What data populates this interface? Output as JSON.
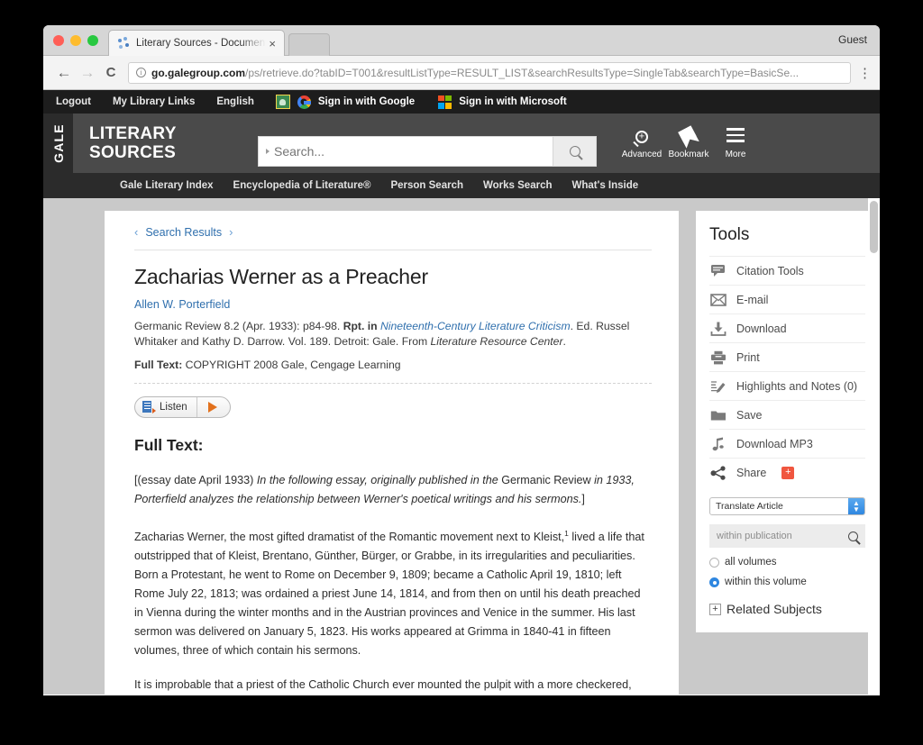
{
  "browser": {
    "tab": {
      "title": "Literary Sources - Document",
      "close": "×",
      "favicon": "spinner-icon"
    },
    "profile_label": "Guest",
    "nav": {
      "back": "←",
      "forward": "→",
      "reload": "C",
      "menu": "⋮"
    },
    "omnibox": {
      "info": "i",
      "host": "go.galegroup.com",
      "path": "/ps/retrieve.do?tabID=T001&resultListType=RESULT_LIST&searchResultsType=SingleTab&searchType=BasicSe...",
      "full_url": "go.galegroup.com/ps/retrieve.do?tabID=T001&resultListType=RESULT_LIST&searchResultsType=SingleTab&searchType=BasicSe..."
    }
  },
  "utility_bar": {
    "links": [
      "Logout",
      "My Library Links",
      "English"
    ],
    "signins": [
      {
        "label": "Sign in with Google",
        "icon": "google-icon",
        "prefix_icon": "google-classroom-icon"
      },
      {
        "label": "Sign in with Microsoft",
        "icon": "microsoft-icon"
      }
    ]
  },
  "masthead": {
    "gale": "GALE",
    "brand_line1": "LITERARY",
    "brand_line2": "SOURCES",
    "search_placeholder": "Search...",
    "search_value": "",
    "actions": [
      {
        "label": "Advanced",
        "icon": "magnifier-plus-icon"
      },
      {
        "label": "Bookmark",
        "icon": "bookmark-ribbon-icon"
      },
      {
        "label": "More",
        "icon": "hamburger-icon"
      }
    ]
  },
  "navbar": {
    "items": [
      "Gale Literary Index",
      "Encyclopedia of Literature®",
      "Person Search",
      "Works Search",
      "What's Inside"
    ]
  },
  "article": {
    "breadcrumb": {
      "prev": "‹",
      "label": "Search Results",
      "next": "›"
    },
    "title": "Zacharias Werner as a Preacher",
    "author": "Allen W. Porterfield",
    "citation_pre": "Germanic Review 8.2 (Apr. 1933): p84-98. ",
    "citation_rpt": "Rpt. in ",
    "citation_link": "Nineteenth-Century Literature Criticism",
    "citation_post": ". Ed. Russel Whitaker and Kathy D. Darrow. Vol. 189. Detroit: Gale. From ",
    "citation_source": "Literature Resource Center",
    "citation_end": ".",
    "copyright_label": "Full Text:",
    "copyright_text": " COPYRIGHT 2008 Gale, Cengage Learning",
    "listen_label": "Listen",
    "fulltext_heading": "Full Text:",
    "paragraphs": [
      {
        "parts": [
          {
            "text": "[(essay date April 1933) ",
            "style": "normal"
          },
          {
            "text": "In the following essay, originally published in the ",
            "style": "italic"
          },
          {
            "text": "Germanic Review ",
            "style": "normal"
          },
          {
            "text": "in 1933, Porterfield analyzes the relationship between Werner's poetical writings and his sermons.",
            "style": "italic"
          },
          {
            "text": "]",
            "style": "normal"
          }
        ]
      },
      {
        "parts": [
          {
            "text": "Zacharias Werner, the most gifted dramatist of the Romantic movement next to Kleist,",
            "style": "normal"
          },
          {
            "text": "1",
            "style": "sup"
          },
          {
            "text": " lived a life that outstripped that of Kleist, Brentano, Günther, Bürger, or Grabbe, in its irregularities and peculiarities. Born a Protestant, he went to Rome on December 9, 1809; became a Catholic April 19, 1810; left Rome July 22, 1813; was ordained a priest June 14, 1814, and from then on until his death preached in Vienna during the winter months and in the Austrian provinces and Venice in the summer. His last sermon was delivered on January 5, 1823. His works appeared at Grimma in 1840-41 in fifteen volumes, three of which contain his sermons.",
            "style": "normal"
          }
        ]
      },
      {
        "parts": [
          {
            "text": "It is improbable that a priest of the Catholic Church ever mounted the pulpit with a more checkered, and in some ways, blotched career behind him. He had been three times married and three times divorced. This was atoned for to a degree in the public eye by his intimate association with Goethe. His transgressions were many and he admitted them: he also confessed them.",
            "style": "normal"
          }
        ]
      }
    ]
  },
  "tools": {
    "title": "Tools",
    "items": [
      {
        "label": "Citation Tools",
        "icon": "citation-icon"
      },
      {
        "label": "E-mail",
        "icon": "envelope-icon"
      },
      {
        "label": "Download",
        "icon": "download-icon"
      },
      {
        "label": "Print",
        "icon": "printer-icon"
      },
      {
        "label": "Highlights and Notes (0)",
        "icon": "highlight-pencil-icon"
      },
      {
        "label": "Save",
        "icon": "folder-icon"
      },
      {
        "label": "Download MP3",
        "icon": "music-note-icon"
      },
      {
        "label": "Share",
        "icon": "share-nodes-icon",
        "badge": "+"
      }
    ],
    "translate_value": "Translate Article",
    "within_publication_placeholder": "within publication",
    "within_publication_value": "",
    "radios": [
      {
        "label": "all volumes",
        "selected": false
      },
      {
        "label": "within this volume",
        "selected": true
      }
    ],
    "related_subjects": "Related Subjects",
    "related_plus": "+"
  },
  "colors": {
    "link_blue": "#2f6fad",
    "masthead_gray": "#4a4a4a",
    "navbar_dark": "#2b2b2b",
    "utility_dark": "#1d1d1d",
    "accent_orange": "#e2711d",
    "share_red": "#f0563f",
    "radio_blue": "#2f87e0",
    "page_bg": "#c9c9c9"
  }
}
